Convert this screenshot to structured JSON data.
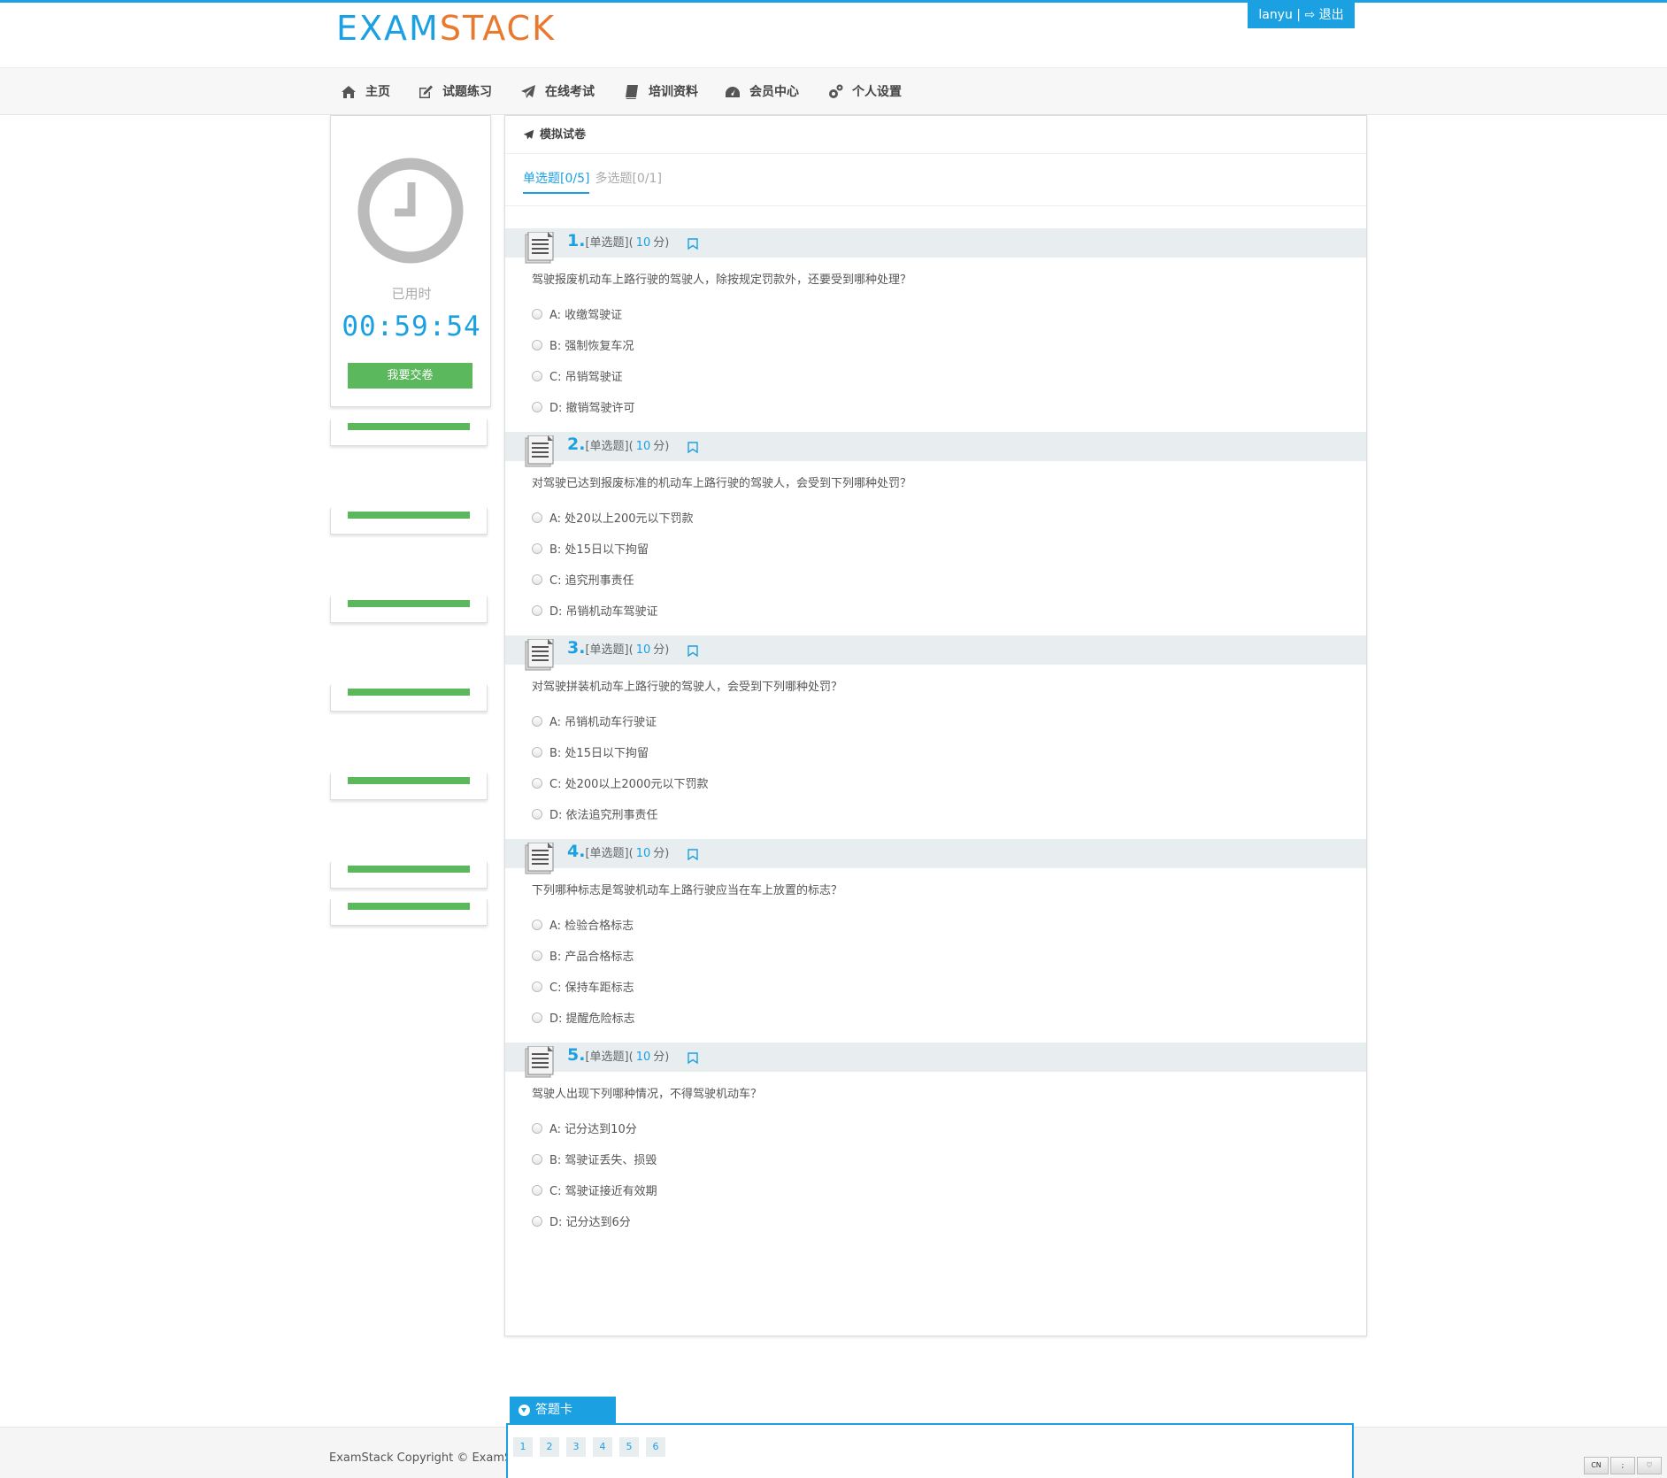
{
  "brand": {
    "part1": "EXAM",
    "part2": "STACK"
  },
  "user": {
    "name": "lanyu",
    "separator": "|",
    "logout": "退出"
  },
  "nav": [
    {
      "label": "主页",
      "icon": "home-icon"
    },
    {
      "label": "试题练习",
      "icon": "edit-icon"
    },
    {
      "label": "在线考试",
      "icon": "paper-plane-icon"
    },
    {
      "label": "培训资料",
      "icon": "book-icon"
    },
    {
      "label": "会员中心",
      "icon": "dashboard-icon"
    },
    {
      "label": "个人设置",
      "icon": "gears-icon"
    }
  ],
  "timer": {
    "label": "已用时",
    "value": "00:59:54",
    "submit": "我要交卷"
  },
  "paper": {
    "title": "模拟试卷",
    "tabs": [
      {
        "label": "单选题[0/5]",
        "active": true
      },
      {
        "label": "多选题[0/1]",
        "active": false
      }
    ]
  },
  "questions": [
    {
      "num": "1.",
      "type": "[单选题]",
      "score_open": "(",
      "score": "10",
      "score_close": "分)",
      "text": "驾驶报废机动车上路行驶的驾驶人，除按规定罚款外，还要受到哪种处理？",
      "options": [
        "A: 收缴驾驶证",
        "B: 强制恢复车况",
        "C: 吊销驾驶证",
        "D: 撤销驾驶许可"
      ]
    },
    {
      "num": "2.",
      "type": "[单选题]",
      "score_open": "(",
      "score": "10",
      "score_close": "分)",
      "text": "对驾驶已达到报废标准的机动车上路行驶的驾驶人，会受到下列哪种处罚？",
      "options": [
        "A: 处20以上200元以下罚款",
        "B: 处15日以下拘留",
        "C: 追究刑事责任",
        "D: 吊销机动车驾驶证"
      ]
    },
    {
      "num": "3.",
      "type": "[单选题]",
      "score_open": "(",
      "score": "10",
      "score_close": "分)",
      "text": "对驾驶拼装机动车上路行驶的驾驶人，会受到下列哪种处罚？",
      "options": [
        "A: 吊销机动车行驶证",
        "B: 处15日以下拘留",
        "C: 处200以上2000元以下罚款",
        "D: 依法追究刑事责任"
      ]
    },
    {
      "num": "4.",
      "type": "[单选题]",
      "score_open": "(",
      "score": "10",
      "score_close": "分)",
      "text": "下列哪种标志是驾驶机动车上路行驶应当在车上放置的标志？",
      "options": [
        "A: 检验合格标志",
        "B: 产品合格标志",
        "C: 保持车距标志",
        "D: 提醒危险标志"
      ]
    },
    {
      "num": "5.",
      "type": "[单选题]",
      "score_open": "(",
      "score": "10",
      "score_close": "分)",
      "text": "驾驶人出现下列哪种情况，不得驾驶机动车？",
      "options": [
        "A: 记分达到10分",
        "B: 驾驶证丢失、损毁",
        "C: 驾驶证接近有效期",
        "D: 记分达到6分"
      ]
    }
  ],
  "answer_card": {
    "label": "答题卡",
    "numbers": [
      "1",
      "2",
      "3",
      "4",
      "5",
      "6"
    ]
  },
  "footer": {
    "copyright": "ExamStack Copyright © ExamSta"
  },
  "tray": {
    "lang": "CN",
    "punct": ";",
    "fav": "♡"
  },
  "colors": {
    "accent": "#1ba0e2",
    "brand_orange": "#e8792e",
    "success": "#5cb85c"
  }
}
